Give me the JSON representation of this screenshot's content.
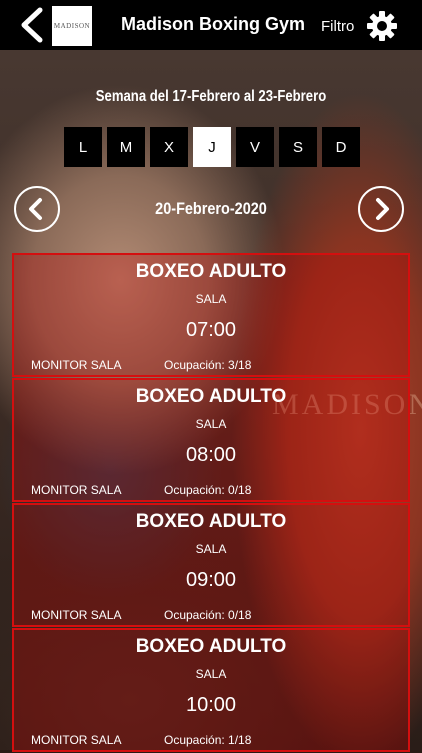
{
  "header": {
    "title": "Madison Boxing Gym",
    "logo_text": "MADISON",
    "filter_label": "Filtro"
  },
  "week": {
    "label": "Semana del 17-Febrero al 23-Febrero",
    "days": [
      "L",
      "M",
      "X",
      "J",
      "V",
      "S",
      "D"
    ],
    "selected_index": 3
  },
  "date": {
    "label": "20-Febrero-2020"
  },
  "background_word": "MADISON",
  "colors": {
    "accent": "#d40f0f",
    "topbar": "#000000"
  },
  "classes": [
    {
      "title": "BOXEO ADULTO",
      "room": "SALA",
      "time": "07:00",
      "monitor": "MONITOR SALA",
      "occupancy": "Ocupación: 3/18"
    },
    {
      "title": "BOXEO ADULTO",
      "room": "SALA",
      "time": "08:00",
      "monitor": "MONITOR SALA",
      "occupancy": "Ocupación: 0/18"
    },
    {
      "title": "BOXEO ADULTO",
      "room": "SALA",
      "time": "09:00",
      "monitor": "MONITOR SALA",
      "occupancy": "Ocupación: 0/18"
    },
    {
      "title": "BOXEO ADULTO",
      "room": "SALA",
      "time": "10:00",
      "monitor": "MONITOR SALA",
      "occupancy": "Ocupación: 1/18"
    }
  ]
}
